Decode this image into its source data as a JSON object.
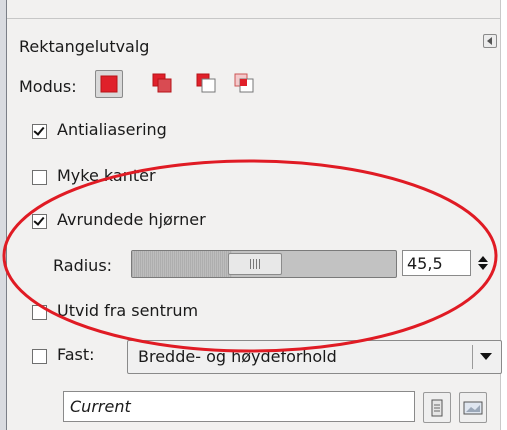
{
  "panel": {
    "title": "Rektangelutvalg",
    "mode_label": "Modus:",
    "modes": [
      {
        "name": "replace-mode",
        "active": true
      },
      {
        "name": "add-mode",
        "active": false
      },
      {
        "name": "subtract-mode",
        "active": false
      },
      {
        "name": "intersect-mode",
        "active": false
      }
    ],
    "antialiasing": {
      "label": "Antialiasering",
      "checked": true
    },
    "feather": {
      "label": "Myke kanter",
      "checked": false
    },
    "rounded": {
      "label": "Avrundede hjørner",
      "checked": true
    },
    "radius": {
      "label": "Radius:",
      "value": "45,5",
      "fraction": 0.38
    },
    "expand": {
      "label": "Utvid fra sentrum",
      "checked": false
    },
    "fixed": {
      "label": "Fast:",
      "checked": false,
      "option": "Bredde- og høydeforhold"
    },
    "current": {
      "value": "Current"
    }
  },
  "colors": {
    "mode_red": "#e0202a",
    "annotation_red": "#e01b24"
  }
}
